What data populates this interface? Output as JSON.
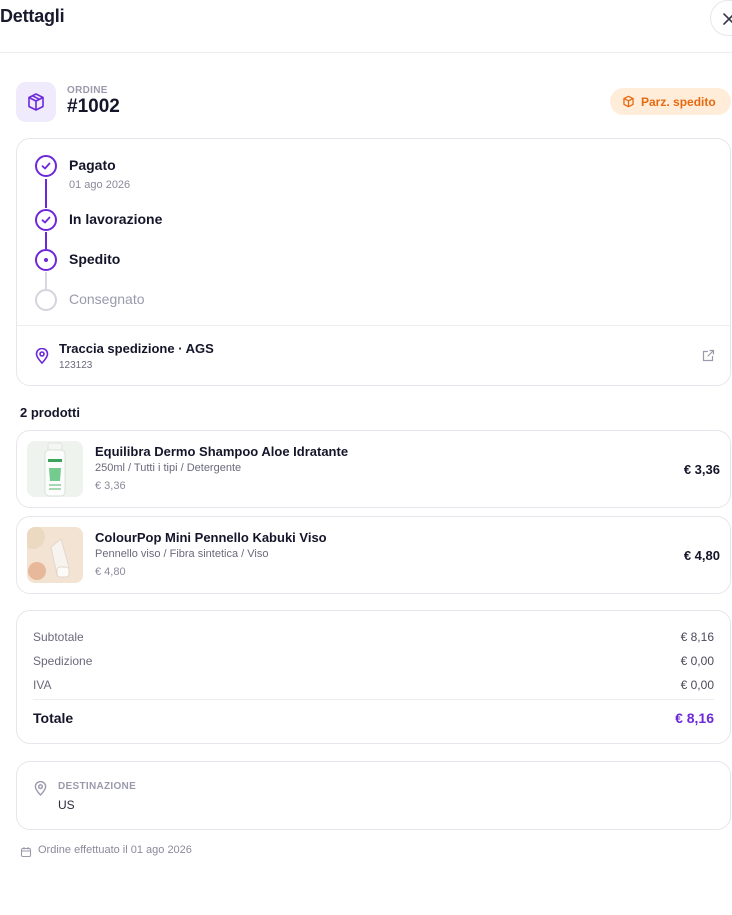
{
  "header": {
    "title": "Dettagli"
  },
  "order": {
    "label": "ORDINE",
    "number": "#1002",
    "status": "Parz. spedito"
  },
  "timeline": {
    "steps": [
      {
        "label": "Pagato",
        "date": "01 ago 2026",
        "state": "done"
      },
      {
        "label": "In lavorazione",
        "state": "done"
      },
      {
        "label": "Spedito",
        "state": "current"
      },
      {
        "label": "Consegnato",
        "state": "pending"
      }
    ],
    "tracking": {
      "title": "Traccia spedizione · AGS",
      "code": "123123"
    }
  },
  "products": {
    "count_label": "2 prodotti",
    "items": [
      {
        "name": "Equilibra Dermo Shampoo Aloe Idratante",
        "variant": "250ml / Tutti i tipi / Detergente",
        "unit_price": "€ 3,36",
        "total": "€ 3,36"
      },
      {
        "name": "ColourPop Mini Pennello Kabuki Viso",
        "variant": "Pennello viso / Fibra sintetica / Viso",
        "unit_price": "€ 4,80",
        "total": "€ 4,80"
      }
    ]
  },
  "summary": {
    "subtotal_label": "Subtotale",
    "subtotal": "€ 8,16",
    "shipping_label": "Spedizione",
    "shipping": "€ 0,00",
    "tax_label": "IVA",
    "tax": "€ 0,00",
    "total_label": "Totale",
    "total": "€ 8,16"
  },
  "destination": {
    "label": "DESTINAZIONE",
    "value": "US"
  },
  "footer": {
    "placed": "Ordine effettuato il 01 ago 2026"
  },
  "colors": {
    "accent": "#6d28d9",
    "status_bg": "#ffedd9",
    "status_text": "#e56a10"
  }
}
